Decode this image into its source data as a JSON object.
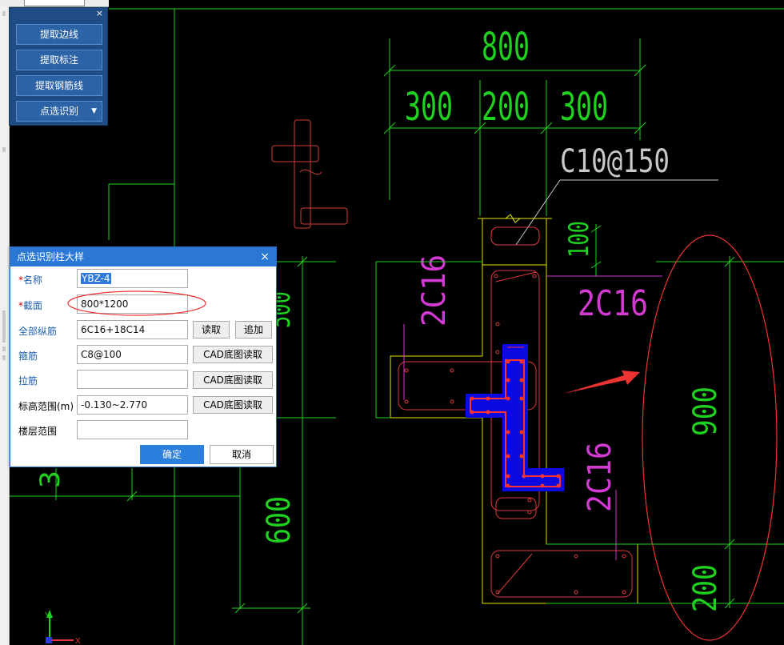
{
  "toolbar": {
    "close_glyph": "×",
    "buttons": [
      "提取边线",
      "提取标注",
      "提取钢筋线",
      "点选识别"
    ],
    "dropdown_caret": "▼"
  },
  "dialog": {
    "title": "点选识别柱大样",
    "close_glyph": "×",
    "required_mark": "*",
    "name_label": "名称",
    "name_value": "YBZ-4",
    "section_label": "截面",
    "section_value": "800*1200",
    "long_rebar_label": "全部纵筋",
    "long_rebar_value": "6C16+18C14",
    "read_button": "读取",
    "append_button": "追加",
    "stirrup_label": "箍筋",
    "stirrup_value": "C8@100",
    "cad_read_button": "CAD底图读取",
    "tie_label": "拉筋",
    "tie_value": "",
    "elev_label": "标高范围(m)",
    "elev_value": "-0.130~2.770",
    "floor_label": "楼层范围",
    "floor_value": "",
    "ok_button": "确定",
    "cancel_button": "取消"
  },
  "drawing": {
    "dim_total": "800",
    "dim_segments": [
      "300",
      "200",
      "300"
    ],
    "stirrup_note": "C10@150",
    "rebar_notes": [
      "2C16",
      "2C16",
      "2C16"
    ],
    "dim_100": "100",
    "dim_900": "900",
    "dim_200": "200",
    "dim_600": "600",
    "dim_left_partial": "500",
    "dim_left_partial2": "3",
    "axis_y_label": "Y",
    "axis_x_label": "X",
    "colors": {
      "dim": "#1fd21f",
      "rebar": "#e23a3a",
      "note": "#d23ad2",
      "outline": "#e6e600",
      "highlight": "#0a0ae0",
      "leader": "#c8c8c8",
      "annotation": "#ee3333"
    }
  }
}
